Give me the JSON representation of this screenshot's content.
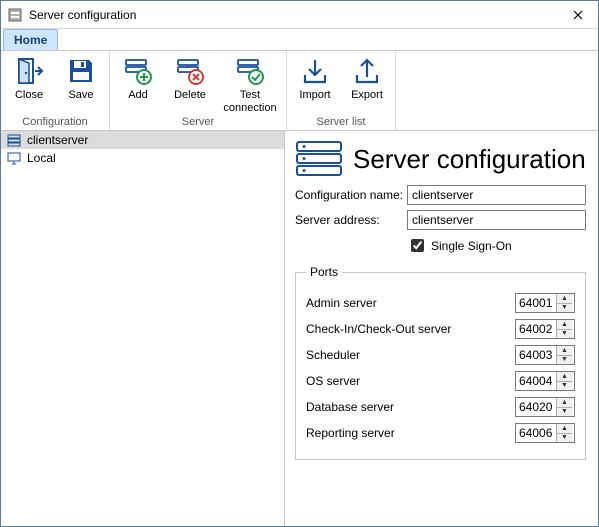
{
  "window": {
    "title": "Server configuration"
  },
  "tabs": {
    "home": "Home"
  },
  "ribbon": {
    "configuration": {
      "label": "Configuration",
      "close": "Close",
      "save": "Save"
    },
    "server": {
      "label": "Server",
      "add": "Add",
      "delete": "Delete",
      "test": "Test\nconnection"
    },
    "serverlist": {
      "label": "Server list",
      "import": "Import",
      "export": "Export"
    }
  },
  "sidebar": {
    "items": [
      {
        "label": "clientserver",
        "selected": true,
        "icon": "server"
      },
      {
        "label": "Local",
        "selected": false,
        "icon": "monitor"
      }
    ]
  },
  "main": {
    "heading": "Server configuration",
    "config_name_label": "Configuration name:",
    "config_name_value": "clientserver",
    "server_addr_label": "Server address:",
    "server_addr_value": "clientserver",
    "sso_label": "Single Sign-On",
    "sso_checked": true,
    "ports_legend": "Ports",
    "ports": [
      {
        "label": "Admin server",
        "value": "64001"
      },
      {
        "label": "Check-In/Check-Out server",
        "value": "64002"
      },
      {
        "label": "Scheduler",
        "value": "64003"
      },
      {
        "label": "OS server",
        "value": "64004"
      },
      {
        "label": "Database server",
        "value": "64020"
      },
      {
        "label": "Reporting server",
        "value": "64006"
      }
    ]
  }
}
